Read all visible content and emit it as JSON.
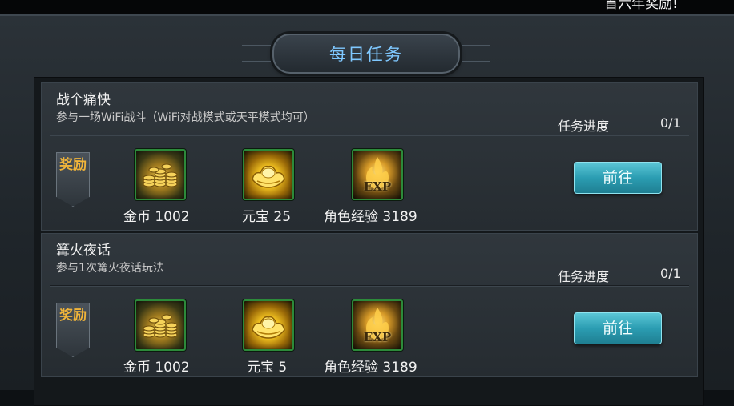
{
  "top_text": "首六年奖励!",
  "title": "每日任务",
  "tasks": [
    {
      "name": "战个痛快",
      "description": "参与一场WiFi战斗（WiFi对战模式或天平模式均可）",
      "progress_label": "任务进度",
      "progress_value": "0/1",
      "reward_tag": "奖励",
      "rewards": [
        {
          "icon": "gold-coins-icon",
          "label": "金币 1002"
        },
        {
          "icon": "gold-ingot-icon",
          "label": "元宝 25"
        },
        {
          "icon": "exp-icon",
          "icon_text": "EXP",
          "label": "角色经验 3189"
        }
      ],
      "button_label": "前往"
    },
    {
      "name": "篝火夜话",
      "description": "参与1次篝火夜话玩法",
      "progress_label": "任务进度",
      "progress_value": "0/1",
      "reward_tag": "奖励",
      "rewards": [
        {
          "icon": "gold-coins-icon",
          "label": "金币 1002"
        },
        {
          "icon": "gold-ingot-icon",
          "label": "元宝 5"
        },
        {
          "icon": "exp-icon",
          "icon_text": "EXP",
          "label": "角色经验 3189"
        }
      ],
      "button_label": "前往"
    }
  ],
  "colors": {
    "title_text": "#7fc8ff",
    "button": "#2b9db2",
    "reward_tag_text": "#f0b43a",
    "icon_border": "#2c8a3a"
  }
}
